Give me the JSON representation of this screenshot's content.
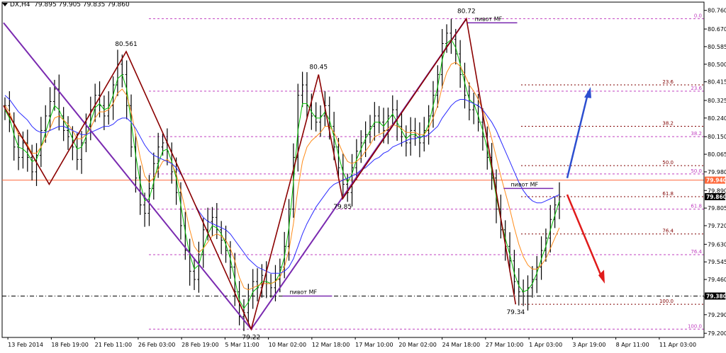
{
  "window": {
    "symbol_label": "DX,H4",
    "ohlc_label": "79.895 79.905 79.835 79.860"
  },
  "colors": {
    "background": "#ffffff",
    "price_line": "#000000",
    "ma_fast": "#00c000",
    "ma_mid": "#ff8c1a",
    "ma_slow": "#2a2aff",
    "zigzag": "#8b0000",
    "channel": "#7a2ab0",
    "fib_line": "#c040c0",
    "current_price_line": "#ff6a3d",
    "up_arrow": "#2d4fd0",
    "down_arrow": "#e01b1b"
  },
  "chart_data": {
    "type": "line",
    "ylim": [
      79.18,
      80.8
    ],
    "y_ticks": [
      "80.760",
      "80.670",
      "80.585",
      "80.500",
      "80.415",
      "80.325",
      "80.240",
      "80.150",
      "80.065",
      "79.980",
      "79.890",
      "79.805",
      "79.720",
      "79.630",
      "79.545",
      "79.460",
      "79.375",
      "79.290",
      "79.200"
    ],
    "x_ticks": [
      "13 Feb 2014",
      "18 Feb 19:00",
      "21 Feb 11:00",
      "26 Feb 03:00",
      "28 Feb 19:00",
      "5 Mar 11:00",
      "10 Mar 02:00",
      "12 Mar 18:00",
      "17 Mar 10:00",
      "20 Mar 02:00",
      "24 Mar 18:00",
      "27 Mar 10:00",
      "1 Apr 03:00",
      "3 Apr 19:00",
      "8 Apr 11:00",
      "11 Apr 03:00"
    ],
    "current_price": {
      "value": 79.94,
      "label": "79.940"
    },
    "last_price": {
      "value": 79.86,
      "label": "79.860"
    },
    "level_marker": {
      "value": 79.38,
      "label": "79.380"
    },
    "zigzag_points": [
      {
        "x": 0.0,
        "y": 80.3
      },
      {
        "x": 3.8,
        "y": 79.92,
        "label": ""
      },
      {
        "x": 10.2,
        "y": 80.561,
        "label": "80.561"
      },
      {
        "x": 20.6,
        "y": 79.22,
        "label": "79.22"
      },
      {
        "x": 26.2,
        "y": 80.45,
        "label": "80.45"
      },
      {
        "x": 28.2,
        "y": 79.85,
        "label": "79.85"
      },
      {
        "x": 38.5,
        "y": 80.72,
        "label": "80.72"
      },
      {
        "x": 42.6,
        "y": 79.34,
        "label": "79.34"
      }
    ],
    "channel_lines": [
      {
        "x1": 0.0,
        "y1": 80.7,
        "x2": 20.6,
        "y2": 79.22
      },
      {
        "x1": 20.6,
        "y1": 79.22,
        "x2": 38.5,
        "y2": 80.72
      }
    ],
    "fib_levels_upper": [
      {
        "label": "0.0",
        "value": 80.72
      },
      {
        "label": "23.6",
        "value": 80.37
      },
      {
        "label": "38.2",
        "value": 80.15
      },
      {
        "label": "50.0",
        "value": 79.97
      },
      {
        "label": "61.8",
        "value": 79.8
      },
      {
        "label": "76.4",
        "value": 79.58
      },
      {
        "label": "100.0",
        "value": 79.22
      }
    ],
    "fib_levels_lower": [
      {
        "label": "23.6",
        "value": 80.4
      },
      {
        "label": "38.2",
        "value": 80.2
      },
      {
        "label": "50.0",
        "value": 80.01
      },
      {
        "label": "61.8",
        "value": 79.86
      },
      {
        "label": "76.4",
        "value": 79.68
      },
      {
        "label": "100.0",
        "value": 79.34
      }
    ],
    "pivot_labels": [
      {
        "text": "пивот МF",
        "x": 38.6,
        "y": 80.7
      },
      {
        "text": "пивот МF",
        "x": 23.2,
        "y": 79.38
      },
      {
        "text": "пивот МF",
        "x": 41.6,
        "y": 79.9
      }
    ],
    "price_series": [
      80.3,
      80.22,
      80.1,
      80.05,
      80.12,
      80.05,
      79.98,
      80.06,
      80.18,
      80.25,
      80.32,
      80.38,
      80.25,
      80.18,
      80.15,
      80.1,
      80.04,
      80.12,
      80.2,
      80.28,
      80.35,
      80.3,
      80.25,
      80.3,
      80.4,
      80.5,
      80.45,
      80.3,
      80.1,
      79.95,
      79.82,
      79.78,
      79.9,
      80.02,
      80.1,
      80.12,
      80.08,
      79.98,
      79.88,
      79.72,
      79.6,
      79.5,
      79.46,
      79.58,
      79.7,
      79.74,
      79.76,
      79.7,
      79.65,
      79.6,
      79.52,
      79.4,
      79.28,
      79.3,
      79.38,
      79.45,
      79.42,
      79.48,
      79.44,
      79.42,
      79.46,
      79.52,
      79.62,
      79.8,
      80.05,
      80.35,
      80.4,
      80.3,
      80.25,
      80.22,
      80.25,
      80.3,
      80.2,
      80.1,
      80.0,
      79.92,
      79.88,
      80.0,
      80.08,
      80.12,
      80.16,
      80.2,
      80.25,
      80.22,
      80.18,
      80.25,
      80.28,
      80.2,
      80.15,
      80.12,
      80.18,
      80.16,
      80.12,
      80.18,
      80.25,
      80.35,
      80.45,
      80.6,
      80.65,
      80.62,
      80.55,
      80.45,
      80.35,
      80.28,
      80.3,
      80.22,
      80.15,
      80.05,
      79.95,
      79.8,
      79.7,
      79.62,
      79.55,
      79.45,
      79.4,
      79.38,
      79.42,
      79.46,
      79.52,
      79.6,
      79.66,
      79.75,
      79.82,
      79.86
    ],
    "series": [
      {
        "name": "",
        "type": "ma_fast",
        "values": [
          80.28,
          80.24,
          80.16,
          80.1,
          80.09,
          80.07,
          80.03,
          80.04,
          80.1,
          80.17,
          80.24,
          80.3,
          80.28,
          80.23,
          80.19,
          80.14,
          80.09,
          80.1,
          80.15,
          80.22,
          80.29,
          80.31,
          80.28,
          80.29,
          80.35,
          80.43,
          80.45,
          80.38,
          80.22,
          80.06,
          79.93,
          79.84,
          79.85,
          79.93,
          80.02,
          80.08,
          80.09,
          80.03,
          79.95,
          79.82,
          79.69,
          79.58,
          79.51,
          79.53,
          79.61,
          79.68,
          79.72,
          79.71,
          79.68,
          79.63,
          79.56,
          79.46,
          79.36,
          79.32,
          79.35,
          79.4,
          79.42,
          79.45,
          79.45,
          79.44,
          79.45,
          79.49,
          79.57,
          79.71,
          79.93,
          80.18,
          80.31,
          80.31,
          80.27,
          80.24,
          80.24,
          80.27,
          80.23,
          80.15,
          80.06,
          79.98,
          79.93,
          79.97,
          80.04,
          80.09,
          80.14,
          80.18,
          80.22,
          80.22,
          80.2,
          80.23,
          80.26,
          80.22,
          80.18,
          80.14,
          80.16,
          80.16,
          80.14,
          80.16,
          80.21,
          80.3,
          80.39,
          80.52,
          80.6,
          80.62,
          80.58,
          80.5,
          80.41,
          80.33,
          80.31,
          80.25,
          80.18,
          80.09,
          79.99,
          79.86,
          79.75,
          79.66,
          79.58,
          79.49,
          79.43,
          79.4,
          79.41,
          79.44,
          79.49,
          79.56,
          79.62,
          79.7,
          79.77,
          79.84
        ]
      },
      {
        "name": "",
        "type": "ma_mid",
        "values": [
          80.3,
          80.27,
          80.21,
          80.16,
          80.14,
          80.11,
          80.07,
          80.07,
          80.1,
          80.14,
          80.19,
          80.24,
          80.25,
          80.23,
          80.21,
          80.18,
          80.14,
          80.14,
          80.16,
          80.19,
          80.24,
          80.27,
          80.27,
          80.28,
          80.31,
          80.36,
          80.38,
          80.35,
          80.27,
          80.16,
          80.05,
          79.96,
          79.93,
          79.95,
          79.99,
          80.03,
          80.04,
          80.02,
          79.97,
          79.89,
          79.8,
          79.7,
          79.62,
          79.59,
          79.61,
          79.64,
          79.67,
          79.68,
          79.67,
          79.65,
          79.61,
          79.55,
          79.47,
          79.42,
          79.41,
          79.42,
          79.43,
          79.44,
          79.44,
          79.44,
          79.45,
          79.47,
          79.52,
          79.6,
          79.73,
          79.9,
          80.03,
          80.1,
          80.13,
          80.15,
          80.17,
          80.2,
          80.2,
          80.17,
          80.12,
          80.07,
          80.03,
          80.02,
          80.03,
          80.05,
          80.08,
          80.11,
          80.15,
          80.16,
          80.17,
          80.19,
          80.21,
          80.2,
          80.19,
          80.17,
          80.17,
          80.17,
          80.16,
          80.16,
          80.19,
          80.24,
          80.3,
          80.39,
          80.46,
          80.5,
          80.51,
          80.49,
          80.45,
          80.4,
          80.37,
          80.33,
          80.28,
          80.22,
          80.14,
          80.05,
          79.96,
          79.88,
          79.8,
          79.71,
          79.63,
          79.57,
          79.53,
          79.51,
          79.51,
          79.53,
          79.56,
          79.61,
          79.66,
          79.71
        ]
      },
      {
        "name": "",
        "type": "ma_slow",
        "values": [
          80.35,
          80.33,
          80.3,
          80.27,
          80.25,
          80.23,
          80.2,
          80.18,
          80.17,
          80.17,
          80.18,
          80.19,
          80.2,
          80.2,
          80.19,
          80.18,
          80.17,
          80.16,
          80.16,
          80.17,
          80.18,
          80.19,
          80.2,
          80.2,
          80.21,
          80.23,
          80.24,
          80.24,
          80.22,
          80.19,
          80.15,
          80.11,
          80.08,
          80.06,
          80.05,
          80.04,
          80.03,
          80.02,
          80.0,
          79.97,
          79.93,
          79.88,
          79.83,
          79.79,
          79.76,
          79.74,
          79.73,
          79.72,
          79.71,
          79.7,
          79.68,
          79.65,
          79.62,
          79.59,
          79.56,
          79.54,
          79.52,
          79.51,
          79.5,
          79.49,
          79.49,
          79.49,
          79.5,
          79.52,
          79.56,
          79.62,
          79.68,
          79.73,
          79.77,
          79.81,
          79.84,
          79.87,
          79.9,
          79.92,
          79.93,
          79.94,
          79.95,
          79.96,
          79.97,
          79.99,
          80.0,
          80.02,
          80.04,
          80.05,
          80.07,
          80.08,
          80.1,
          80.11,
          80.12,
          80.13,
          80.14,
          80.14,
          80.15,
          80.15,
          80.16,
          80.18,
          80.2,
          80.24,
          80.27,
          80.3,
          80.32,
          80.33,
          80.33,
          80.32,
          80.31,
          80.3,
          80.28,
          80.25,
          80.22,
          80.18,
          80.13,
          80.08,
          80.03,
          79.98,
          79.93,
          79.89,
          79.86,
          79.84,
          79.83,
          79.83,
          79.84,
          79.85,
          79.86,
          79.87
        ]
      }
    ],
    "bars": 124
  }
}
